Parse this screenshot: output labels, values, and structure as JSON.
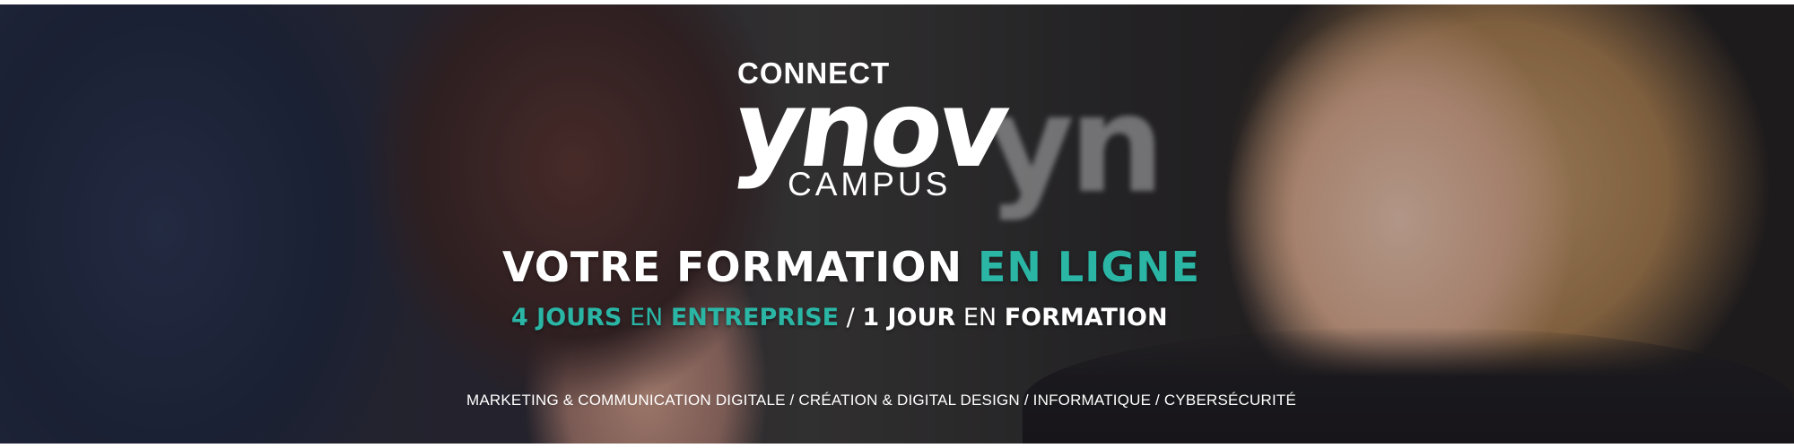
{
  "logo": {
    "top": "CONNECT",
    "brand": "ynov",
    "bottom": "CAMPUS"
  },
  "headline": {
    "part1": "VOTRE FORMATION",
    "part2": "EN LIGNE"
  },
  "subline": {
    "days_company_number": "4 JOURS",
    "days_company_rest": "EN",
    "company": "ENTREPRISE",
    "separator": "/",
    "days_training_number": "1 JOUR",
    "days_training_rest": "EN",
    "training": "FORMATION"
  },
  "programs": "MARKETING & COMMUNICATION DIGITALE /  CRÉATION & DIGITAL DESIGN / INFORMATIQUE / CYBERSÉCURITÉ",
  "colors": {
    "accent": "#2ab5a5",
    "text": "#ffffff"
  }
}
